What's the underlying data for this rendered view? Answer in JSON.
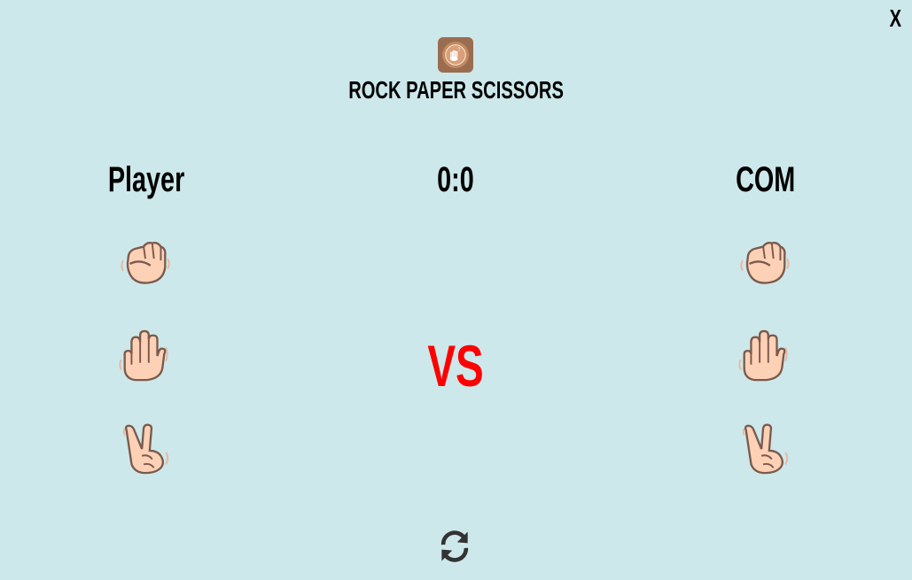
{
  "window": {
    "close_label": "X"
  },
  "header": {
    "title": "ROCK PAPER SCISSORS",
    "logo_icon": "rock-paper-scissors-logo-icon"
  },
  "player": {
    "label": "Player",
    "choices": [
      "rock",
      "paper",
      "scissors"
    ]
  },
  "score": {
    "display": "0:0"
  },
  "com": {
    "label": "COM",
    "choices": [
      "rock",
      "paper",
      "scissors"
    ]
  },
  "center": {
    "vs_label": "VS"
  },
  "controls": {
    "reset_icon": "refresh-icon"
  },
  "colors": {
    "background": "#cde8ea",
    "vs": "#ff0000",
    "skin": "#fdd1b5",
    "skin_outline": "#7a5a4e",
    "logo_bg": "#9a6d51",
    "reset_icon": "#333333"
  }
}
